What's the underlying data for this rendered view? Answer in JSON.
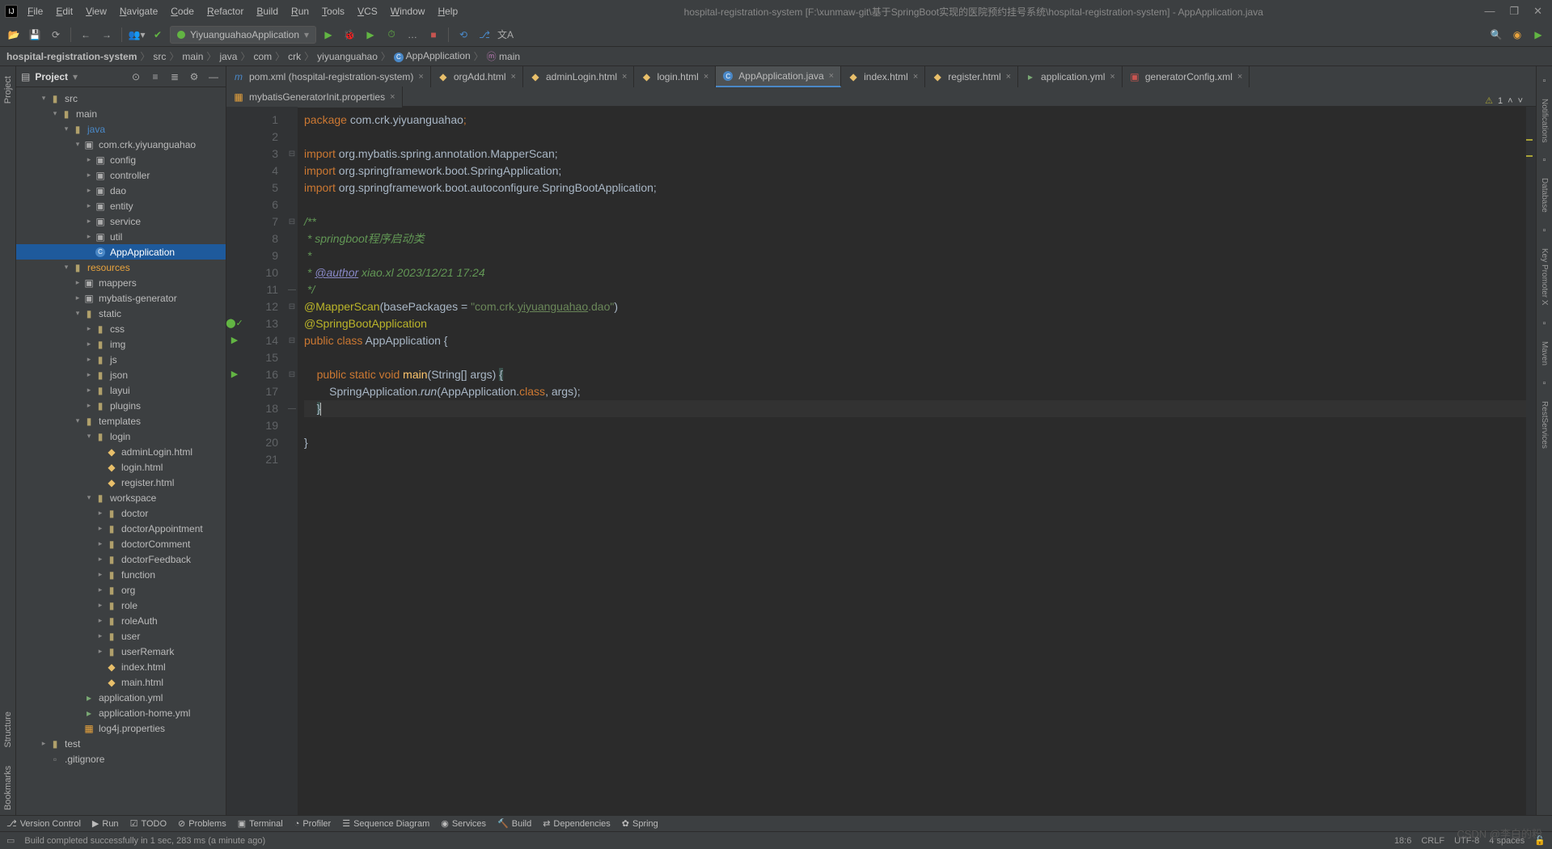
{
  "window": {
    "title": "hospital-registration-system [F:\\xunmaw-git\\基于SpringBoot实现的医院预约挂号系统\\hospital-registration-system] - AppApplication.java"
  },
  "menu": [
    "File",
    "Edit",
    "View",
    "Navigate",
    "Code",
    "Refactor",
    "Build",
    "Run",
    "Tools",
    "VCS",
    "Window",
    "Help"
  ],
  "runConfig": "YiyuanguahaoApplication",
  "breadcrumbs": [
    "hospital-registration-system",
    "src",
    "main",
    "java",
    "com",
    "crk",
    "yiyuanguahao",
    "AppApplication",
    "main"
  ],
  "projectPanel": {
    "title": "Project"
  },
  "tree": [
    {
      "d": 2,
      "a": "v",
      "i": "folder",
      "t": "src"
    },
    {
      "d": 3,
      "a": "v",
      "i": "folder",
      "t": "main"
    },
    {
      "d": 4,
      "a": "v",
      "i": "folder",
      "t": "java",
      "cls": "blue"
    },
    {
      "d": 5,
      "a": "v",
      "i": "pkg",
      "t": "com.crk.yiyuanguahao"
    },
    {
      "d": 6,
      "a": ">",
      "i": "pkg",
      "t": "config"
    },
    {
      "d": 6,
      "a": ">",
      "i": "pkg",
      "t": "controller"
    },
    {
      "d": 6,
      "a": ">",
      "i": "pkg",
      "t": "dao"
    },
    {
      "d": 6,
      "a": ">",
      "i": "pkg",
      "t": "entity"
    },
    {
      "d": 6,
      "a": ">",
      "i": "pkg",
      "t": "service"
    },
    {
      "d": 6,
      "a": ">",
      "i": "pkg",
      "t": "util"
    },
    {
      "d": 6,
      "a": " ",
      "i": "class",
      "t": "AppApplication",
      "sel": true
    },
    {
      "d": 4,
      "a": "v",
      "i": "folder",
      "t": "resources",
      "cls": "orange"
    },
    {
      "d": 5,
      "a": ">",
      "i": "pkg",
      "t": "mappers"
    },
    {
      "d": 5,
      "a": ">",
      "i": "pkg",
      "t": "mybatis-generator"
    },
    {
      "d": 5,
      "a": "v",
      "i": "folder",
      "t": "static"
    },
    {
      "d": 6,
      "a": ">",
      "i": "folder",
      "t": "css"
    },
    {
      "d": 6,
      "a": ">",
      "i": "folder",
      "t": "img"
    },
    {
      "d": 6,
      "a": ">",
      "i": "folder",
      "t": "js"
    },
    {
      "d": 6,
      "a": ">",
      "i": "folder",
      "t": "json"
    },
    {
      "d": 6,
      "a": ">",
      "i": "folder",
      "t": "layui"
    },
    {
      "d": 6,
      "a": ">",
      "i": "folder",
      "t": "plugins"
    },
    {
      "d": 5,
      "a": "v",
      "i": "folder",
      "t": "templates"
    },
    {
      "d": 6,
      "a": "v",
      "i": "folder",
      "t": "login"
    },
    {
      "d": 7,
      "a": " ",
      "i": "html",
      "t": "adminLogin.html"
    },
    {
      "d": 7,
      "a": " ",
      "i": "html",
      "t": "login.html"
    },
    {
      "d": 7,
      "a": " ",
      "i": "html",
      "t": "register.html"
    },
    {
      "d": 6,
      "a": "v",
      "i": "folder",
      "t": "workspace"
    },
    {
      "d": 7,
      "a": ">",
      "i": "folder",
      "t": "doctor"
    },
    {
      "d": 7,
      "a": ">",
      "i": "folder",
      "t": "doctorAppointment"
    },
    {
      "d": 7,
      "a": ">",
      "i": "folder",
      "t": "doctorComment"
    },
    {
      "d": 7,
      "a": ">",
      "i": "folder",
      "t": "doctorFeedback"
    },
    {
      "d": 7,
      "a": ">",
      "i": "folder",
      "t": "function"
    },
    {
      "d": 7,
      "a": ">",
      "i": "folder",
      "t": "org"
    },
    {
      "d": 7,
      "a": ">",
      "i": "folder",
      "t": "role"
    },
    {
      "d": 7,
      "a": ">",
      "i": "folder",
      "t": "roleAuth"
    },
    {
      "d": 7,
      "a": ">",
      "i": "folder",
      "t": "user"
    },
    {
      "d": 7,
      "a": ">",
      "i": "folder",
      "t": "userRemark"
    },
    {
      "d": 7,
      "a": " ",
      "i": "html",
      "t": "index.html"
    },
    {
      "d": 7,
      "a": " ",
      "i": "html",
      "t": "main.html"
    },
    {
      "d": 5,
      "a": " ",
      "i": "yml",
      "t": "application.yml"
    },
    {
      "d": 5,
      "a": " ",
      "i": "yml",
      "t": "application-home.yml"
    },
    {
      "d": 5,
      "a": " ",
      "i": "prop",
      "t": "log4j.properties"
    },
    {
      "d": 2,
      "a": ">",
      "i": "folder",
      "t": "test"
    },
    {
      "d": 2,
      "a": " ",
      "i": "file",
      "t": ".gitignore"
    }
  ],
  "tabs1": [
    {
      "t": "pom.xml (hospital-registration-system)",
      "i": "m"
    },
    {
      "t": "orgAdd.html",
      "i": "html"
    },
    {
      "t": "adminLogin.html",
      "i": "html"
    },
    {
      "t": "login.html",
      "i": "html"
    },
    {
      "t": "AppApplication.java",
      "i": "class",
      "active": true
    },
    {
      "t": "index.html",
      "i": "html"
    },
    {
      "t": "register.html",
      "i": "html"
    },
    {
      "t": "application.yml",
      "i": "yml"
    },
    {
      "t": "generatorConfig.xml",
      "i": "xml"
    }
  ],
  "tabs2": [
    {
      "t": "mybatisGeneratorInit.properties",
      "i": "prop"
    }
  ],
  "inspections": {
    "warnings": 1
  },
  "code": {
    "lines": 21,
    "l1": "package com.crk.yiyuanguahao;",
    "l3": "import org.mybatis.spring.annotation.MapperScan;",
    "l4": "import org.springframework.boot.SpringApplication;",
    "l5": "import org.springframework.boot.autoconfigure.SpringBootApplication;",
    "l7": "/**",
    "l8": " * springboot程序启动类",
    "l9": " *",
    "l10a": " * ",
    "l10b": "@author",
    "l10c": " xiao.xl 2023/12/21 17:24",
    "l11": " */",
    "l12a": "@MapperScan",
    "l12b": "(basePackages = ",
    "l12c": "\"com.crk.",
    "l12d": "yiyuanguahao",
    "l12e": ".dao\"",
    "l12f": ")",
    "l13": "@SpringBootApplication",
    "l14a": "public class ",
    "l14b": "AppApplication ",
    "l14c": "{",
    "l16a": "    public static void ",
    "l16b": "main",
    "l16c": "(String[] args) ",
    "l16d": "{",
    "l17a": "        SpringApplication.",
    "l17b": "run",
    "l17c": "(AppApplication.",
    "l17d": "class",
    "l17e": ", args);",
    "l18": "    }",
    "l20": "}"
  },
  "tools": [
    "Version Control",
    "Run",
    "TODO",
    "Problems",
    "Terminal",
    "Profiler",
    "Sequence Diagram",
    "Services",
    "Build",
    "Dependencies",
    "Spring"
  ],
  "status": {
    "msg": "Build completed successfully in 1 sec, 283 ms (a minute ago)",
    "pos": "18:6",
    "eol": "CRLF",
    "enc": "UTF-8",
    "indent": "4 spaces"
  },
  "rightGutter": [
    "Notifications",
    "Database",
    "Key Promoter X",
    "Maven",
    "RestServices"
  ],
  "watermark": "CSDN @李白的粉"
}
